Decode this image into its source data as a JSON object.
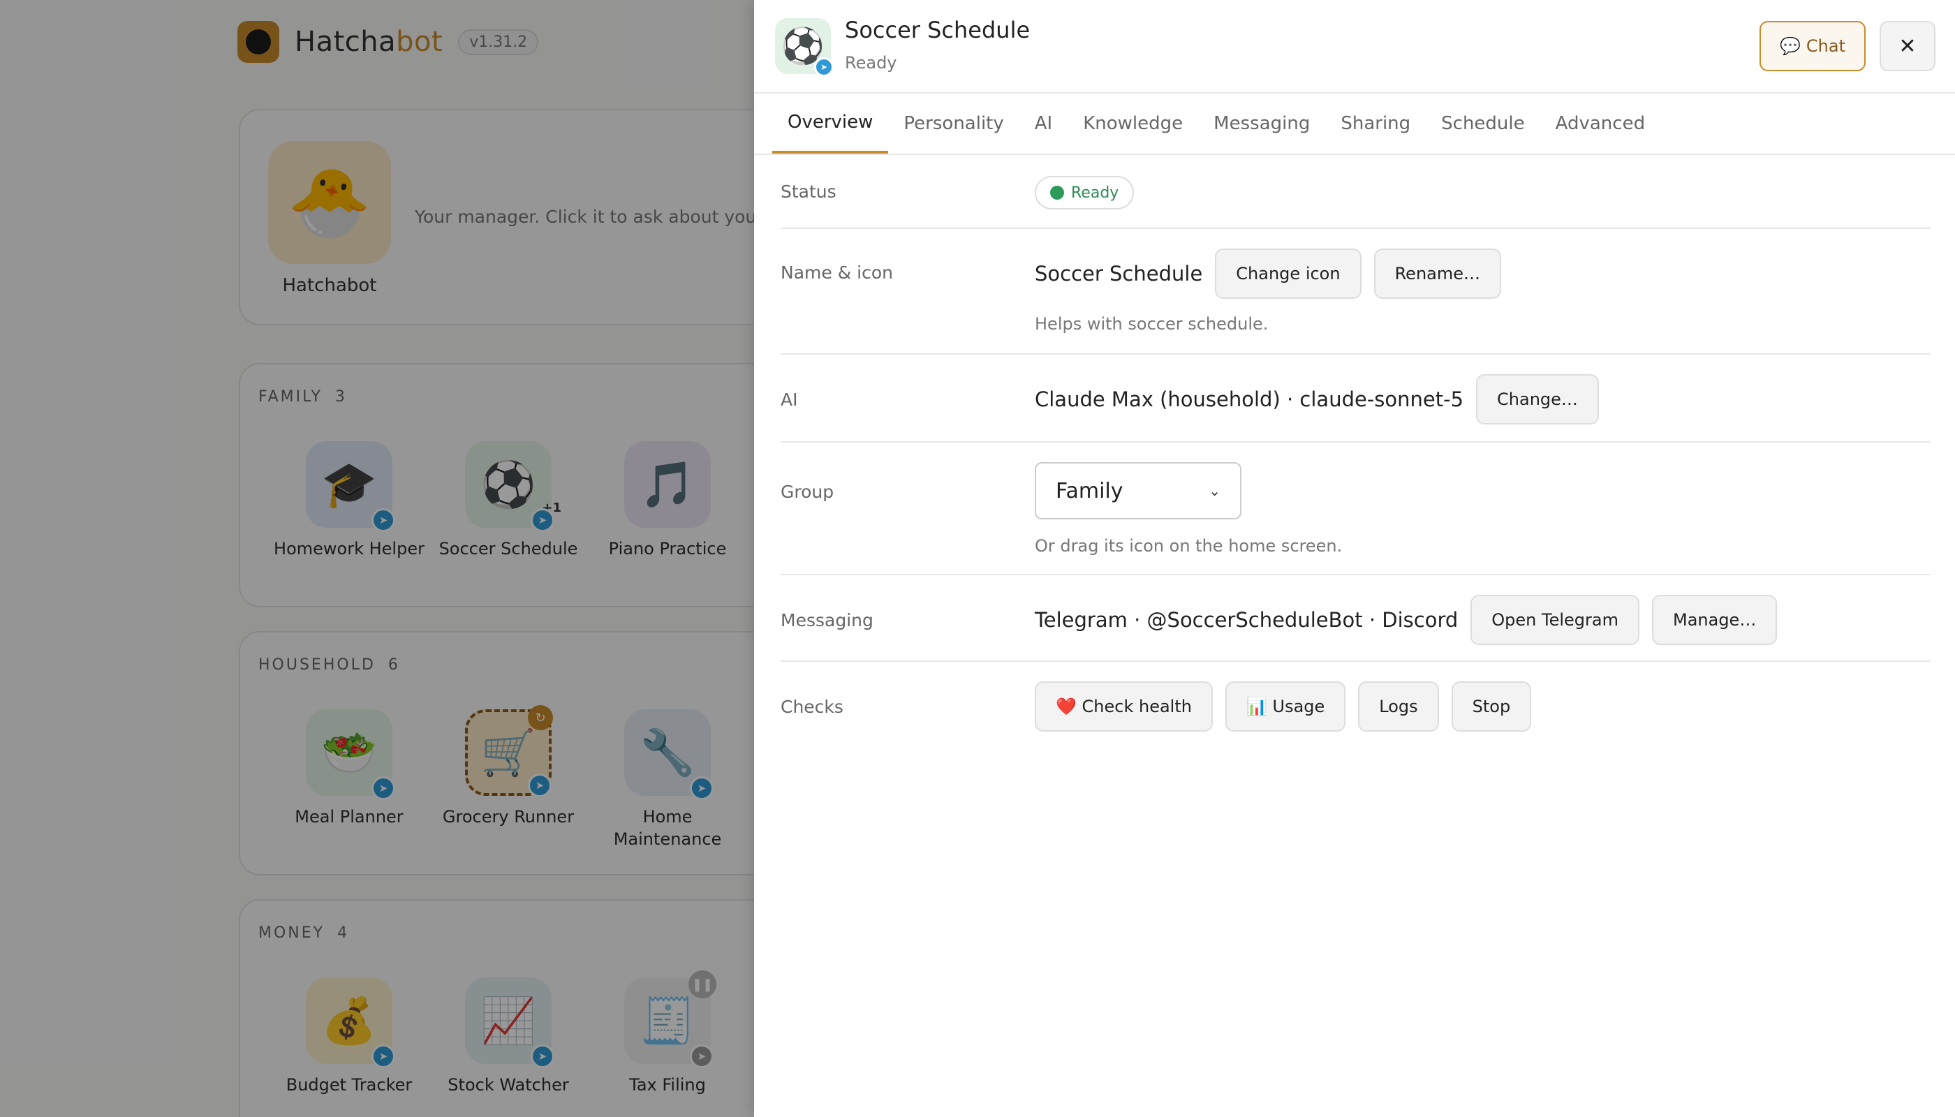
{
  "app": {
    "brand_main": "Hatcha",
    "brand_accent": "bot",
    "version": "v1.31.2"
  },
  "manager": {
    "name": "Hatchabot",
    "icon": "hatching-chick-icon",
    "description": "Your manager. Click it to ask about your ag"
  },
  "groups": [
    {
      "title": "FAMILY",
      "count": "3",
      "agents": [
        {
          "name": "Homework Helper",
          "icon": "graduation-cap-icon"
        },
        {
          "name": "Soccer Schedule",
          "icon": "soccer-ball-icon",
          "extra": "+1"
        },
        {
          "name": "Piano Practice",
          "icon": "music-note-icon"
        }
      ]
    },
    {
      "title": "HOUSEHOLD",
      "count": "6",
      "agents": [
        {
          "name": "Meal Planner",
          "icon": "salad-icon"
        },
        {
          "name": "Grocery Runner",
          "icon": "shopping-cart-icon"
        },
        {
          "name": "Home Maintenance",
          "icon": "wrench-icon"
        }
      ]
    },
    {
      "title": "MONEY",
      "count": "4",
      "agents": [
        {
          "name": "Budget Tracker",
          "icon": "money-bag-icon"
        },
        {
          "name": "Stock Watcher",
          "icon": "chart-increasing-icon"
        },
        {
          "name": "Tax Filing",
          "icon": "receipt-icon"
        }
      ]
    }
  ],
  "drawer": {
    "title": "Soccer Schedule",
    "status": "Ready",
    "icon": "soccer-ball-icon",
    "chat_label": "Chat",
    "close_icon": "close-icon",
    "tabs": [
      "Overview",
      "Personality",
      "AI",
      "Knowledge",
      "Messaging",
      "Sharing",
      "Schedule",
      "Advanced"
    ],
    "active_tab": "Overview",
    "rows": {
      "status": {
        "label": "Status",
        "badge": "Ready"
      },
      "name": {
        "label": "Name & icon",
        "value": "Soccer Schedule",
        "change_icon": "Change icon",
        "rename": "Rename…",
        "hint": "Helps with soccer schedule."
      },
      "ai": {
        "label": "AI",
        "value": "Claude Max (household) · claude-sonnet-5",
        "change": "Change…"
      },
      "group": {
        "label": "Group",
        "selected": "Family",
        "hint": "Or drag its icon on the home screen."
      },
      "messaging": {
        "label": "Messaging",
        "value": "Telegram · @SoccerScheduleBot · Discord",
        "open": "Open Telegram",
        "manage": "Manage…"
      },
      "checks": {
        "label": "Checks",
        "health": "Check health",
        "usage": "Usage",
        "logs": "Logs",
        "stop": "Stop"
      }
    }
  },
  "colors": {
    "accent": "#c98a2a",
    "telegram": "#2f9ad6",
    "ready": "#2e9a5a"
  }
}
